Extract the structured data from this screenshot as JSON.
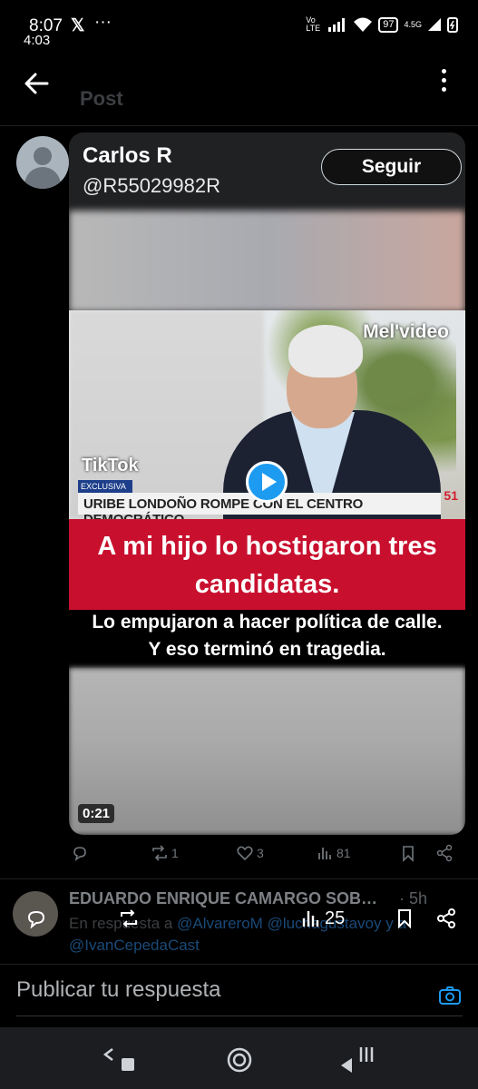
{
  "status": {
    "time": "8:07",
    "time_secondary": "4:03",
    "battery": "97",
    "network": "4.5G",
    "carrier_tag": "Vo LTE"
  },
  "header": {
    "title": "Post"
  },
  "tweet": {
    "display_name": "Carlos R",
    "handle": "@R55029982R",
    "follow_label": "Seguir",
    "video": {
      "watermark": "Mel'video",
      "tiktok_label": "TikTok",
      "tag": "EXCLUSIVA",
      "lower_third": "URIBE LONDOÑO ROMPE CON EL CENTRO DEMOCRÁTICO",
      "channel": "51",
      "banner_line1": "A mi hijo lo hostigaron tres",
      "banner_line2": "candidatas.",
      "subtitle_line1": "Lo empujaron a hacer política de calle.",
      "subtitle_line2": "Y eso terminó en tragedia.",
      "duration": "0:21"
    },
    "actions": {
      "reposts": "1",
      "likes": "3",
      "views": "81"
    }
  },
  "reply": {
    "author": "EDUARDO ENRIQUE CAMARGO SOB…",
    "time": "· 5h",
    "reply_prefix": "En respuesta a",
    "mention1": "@AlvareroM",
    "mention2": "@luchagustavoy y a",
    "mention3": "@IvanCepedaCast"
  },
  "overlay_actions": {
    "views": "25"
  },
  "composer": {
    "placeholder": "Publicar tu respuesta"
  }
}
